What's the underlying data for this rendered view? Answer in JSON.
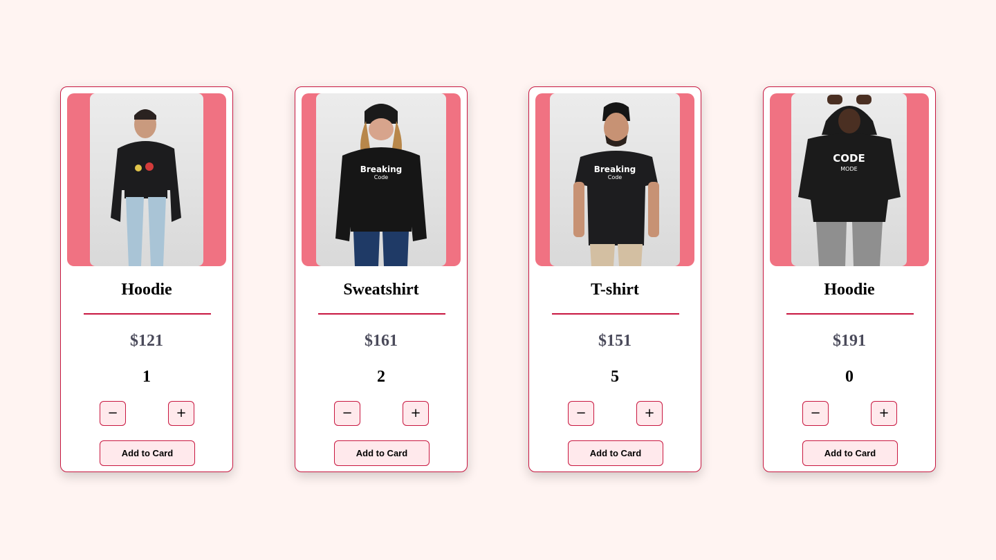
{
  "products": [
    {
      "name": "Hoodie",
      "price": "$121",
      "quantity": "1",
      "minus_label": "−",
      "plus_label": "+",
      "add_label": "Add to Card",
      "image": "man-in-black-hoodie-photo",
      "print_text": "",
      "print_sub": ""
    },
    {
      "name": "Sweatshirt",
      "price": "$161",
      "quantity": "2",
      "minus_label": "−",
      "plus_label": "+",
      "add_label": "Add to Card",
      "image": "man-in-black-sweatshirt-photo",
      "print_text": "Breaking",
      "print_sub": "Code"
    },
    {
      "name": "T-shirt",
      "price": "$151",
      "quantity": "5",
      "minus_label": "−",
      "plus_label": "+",
      "add_label": "Add to Card",
      "image": "man-in-black-tshirt-photo",
      "print_text": "Breaking",
      "print_sub": "Code"
    },
    {
      "name": "Hoodie",
      "price": "$191",
      "quantity": "0",
      "minus_label": "−",
      "plus_label": "+",
      "add_label": "Add to Card",
      "image": "man-in-black-hoodie-code-mode-photo",
      "print_text": "CODE",
      "print_sub": "MODE"
    }
  ],
  "colors": {
    "page_background": "#fff4f2",
    "accent": "#c8163f",
    "image_backdrop": "#f07282",
    "button_fill": "#ffe9ec",
    "price_text": "#4a4a5a"
  }
}
